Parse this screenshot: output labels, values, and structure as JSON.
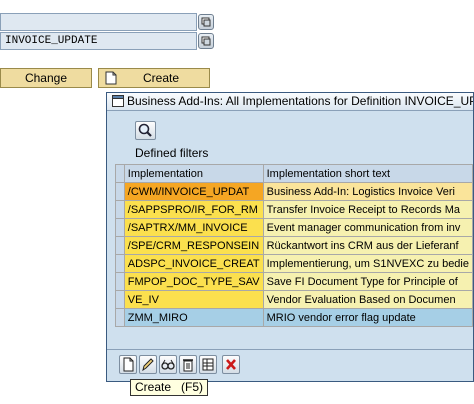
{
  "fields": {
    "field1_value": "",
    "field2_value": "INVOICE_UPDATE"
  },
  "buttons": {
    "change_label": "Change",
    "create_label": "Create"
  },
  "popup": {
    "title": "Business Add-Ins: All Implementations for Definition INVOICE_UPDAT",
    "defined_filters_label": "Defined filters",
    "table": {
      "headers": [
        "Implementation",
        "Implementation short text"
      ],
      "rows": [
        {
          "implementation": "/CWM/INVOICE_UPDAT",
          "text": "Business Add-In: Logistics Invoice Veri"
        },
        {
          "implementation": "/SAPPSPRO/IR_FOR_RM",
          "text": "Transfer Invoice Receipt to Records Ma"
        },
        {
          "implementation": "/SAPTRX/MM_INVOICE",
          "text": "Event manager communication from inv"
        },
        {
          "implementation": "/SPE/CRM_RESPONSEIN",
          "text": "Rückantwort ins CRM aus der Lieferanf"
        },
        {
          "implementation": "ADSPC_INVOICE_CREAT",
          "text": "Implementierung, um S1NVEXC zu bedie"
        },
        {
          "implementation": "FMPOP_DOC_TYPE_SAV",
          "text": "Save FI Document Type for Principle of"
        },
        {
          "implementation": "VE_IV",
          "text": "Vendor Evaluation Based on Documen"
        },
        {
          "implementation": "ZMM_MIRO",
          "text": "MRIO vendor error flag update"
        }
      ]
    },
    "tooltip": "Create   (F5)"
  },
  "icons": {
    "f4": "value-help-icon",
    "create": "create-document-icon",
    "title": "popup-window-icon",
    "filter": "filter-magnifier-icon",
    "toolbar": [
      "create-document-icon",
      "edit-pencil-icon",
      "display-glasses-icon",
      "delete-trash-icon",
      "layout-grid-icon",
      "cancel-icon"
    ]
  }
}
